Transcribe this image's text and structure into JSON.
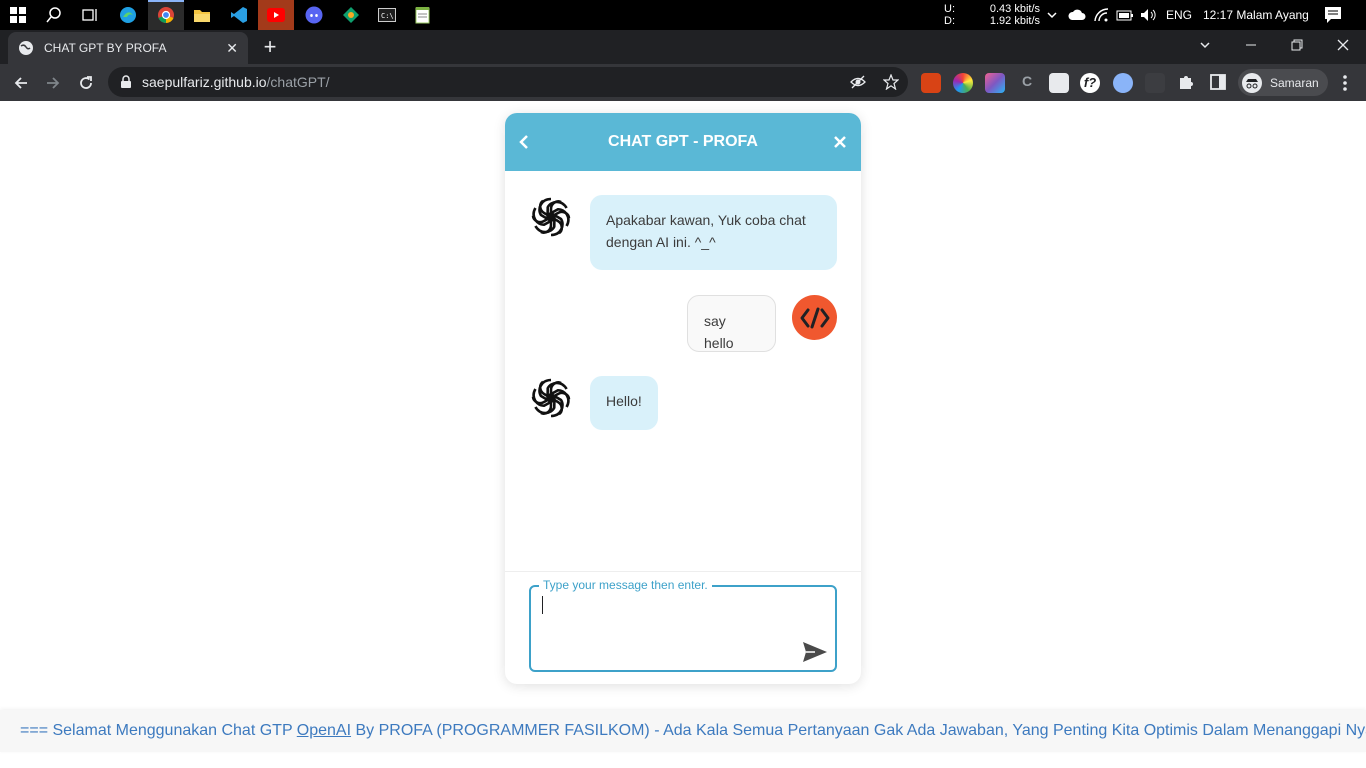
{
  "taskbar": {
    "net_up_label": "U:",
    "net_down_label": "D:",
    "net_up_value": "0.43 kbit/s",
    "net_down_value": "1.92 kbit/s",
    "language": "ENG",
    "clock": "12:17 Malam Ayang"
  },
  "browser": {
    "tab_title": "CHAT GPT BY PROFA",
    "url_host": "saepulfariz.github.io",
    "url_path": "/chatGPT/",
    "profile_name": "Samaran"
  },
  "chat": {
    "title": "CHAT GPT - PROFA",
    "messages": [
      {
        "role": "ai",
        "text": "Apakabar kawan, Yuk coba chat dengan AI ini. ^_^"
      },
      {
        "role": "user",
        "text": "say hello"
      },
      {
        "role": "ai",
        "text": "Hello!"
      }
    ],
    "input_label": "Type your message then enter.",
    "input_value": ""
  },
  "marquee": {
    "prefix": "=== Selamat Menggunakan Chat GTP ",
    "link": "OpenAI",
    "suffix": " By PROFA (PROGRAMMER FASILKOM) - Ada Kala Semua Pertanyaan Gak Ada Jawaban, Yang Penting Kita Optimis Dalam Menanggapi Nya. - Au"
  },
  "colors": {
    "header": "#5ab8d6",
    "ai_bubble": "#d9f1fa",
    "user_avatar": "#f0582f",
    "input_border": "#3da1c9",
    "marquee_text": "#3d7abf"
  }
}
